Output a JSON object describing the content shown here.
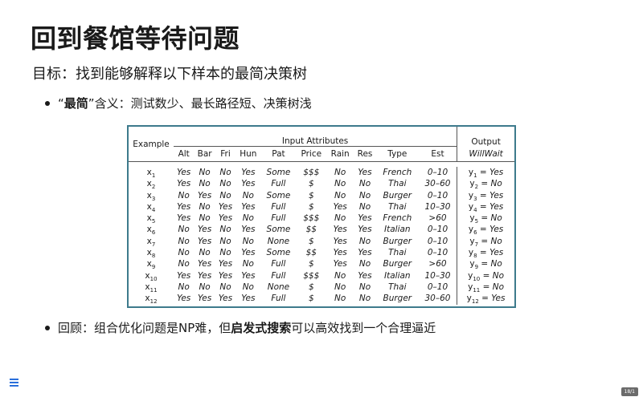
{
  "slide": {
    "title": "回到餐馆等待问题",
    "goal": "目标：找到能够解释以下样本的最简决策树",
    "bullet1": {
      "open_quote": "“",
      "bold": "最简",
      "rest": "”含义：测试数少、最长路径短、决策树浅"
    },
    "bullet2": {
      "pre": "回顾：组合优化问题是NP难，但",
      "bold": "启发式搜索",
      "post": "可以高效找到一个合理逼近"
    },
    "page_number": "18/1"
  },
  "table": {
    "example_header": "Example",
    "input_header": "Input Attributes",
    "output_header": "Output",
    "columns": [
      "Alt",
      "Bar",
      "Fri",
      "Hun",
      "Pat",
      "Price",
      "Rain",
      "Res",
      "Type",
      "Est"
    ],
    "output_column": "WillWait",
    "rows": [
      {
        "ex": "x",
        "n": "1",
        "vals": [
          "Yes",
          "No",
          "No",
          "Yes",
          "Some",
          "$$$",
          "No",
          "Yes",
          "French",
          "0–10"
        ],
        "out": "Yes"
      },
      {
        "ex": "x",
        "n": "2",
        "vals": [
          "Yes",
          "No",
          "No",
          "Yes",
          "Full",
          "$",
          "No",
          "No",
          "Thai",
          "30–60"
        ],
        "out": "No"
      },
      {
        "ex": "x",
        "n": "3",
        "vals": [
          "No",
          "Yes",
          "No",
          "No",
          "Some",
          "$",
          "No",
          "No",
          "Burger",
          "0–10"
        ],
        "out": "Yes"
      },
      {
        "ex": "x",
        "n": "4",
        "vals": [
          "Yes",
          "No",
          "Yes",
          "Yes",
          "Full",
          "$",
          "Yes",
          "No",
          "Thai",
          "10–30"
        ],
        "out": "Yes"
      },
      {
        "ex": "x",
        "n": "5",
        "vals": [
          "Yes",
          "No",
          "Yes",
          "No",
          "Full",
          "$$$",
          "No",
          "Yes",
          "French",
          ">60"
        ],
        "out": "No"
      },
      {
        "ex": "x",
        "n": "6",
        "vals": [
          "No",
          "Yes",
          "No",
          "Yes",
          "Some",
          "$$",
          "Yes",
          "Yes",
          "Italian",
          "0–10"
        ],
        "out": "Yes"
      },
      {
        "ex": "x",
        "n": "7",
        "vals": [
          "No",
          "Yes",
          "No",
          "No",
          "None",
          "$",
          "Yes",
          "No",
          "Burger",
          "0–10"
        ],
        "out": "No"
      },
      {
        "ex": "x",
        "n": "8",
        "vals": [
          "No",
          "No",
          "No",
          "Yes",
          "Some",
          "$$",
          "Yes",
          "Yes",
          "Thai",
          "0–10"
        ],
        "out": "Yes"
      },
      {
        "ex": "x",
        "n": "9",
        "vals": [
          "No",
          "Yes",
          "Yes",
          "No",
          "Full",
          "$",
          "Yes",
          "No",
          "Burger",
          ">60"
        ],
        "out": "No"
      },
      {
        "ex": "x",
        "n": "10",
        "vals": [
          "Yes",
          "Yes",
          "Yes",
          "Yes",
          "Full",
          "$$$",
          "No",
          "Yes",
          "Italian",
          "10–30"
        ],
        "out": "No"
      },
      {
        "ex": "x",
        "n": "11",
        "vals": [
          "No",
          "No",
          "No",
          "No",
          "None",
          "$",
          "No",
          "No",
          "Thai",
          "0–10"
        ],
        "out": "No"
      },
      {
        "ex": "x",
        "n": "12",
        "vals": [
          "Yes",
          "Yes",
          "Yes",
          "Yes",
          "Full",
          "$",
          "No",
          "No",
          "Burger",
          "30–60"
        ],
        "out": "Yes"
      }
    ]
  },
  "ui": {
    "menu_icon": "hamburger-menu-icon",
    "accent_color": "#2a6fdb",
    "table_border_color": "#3d7a8c"
  }
}
